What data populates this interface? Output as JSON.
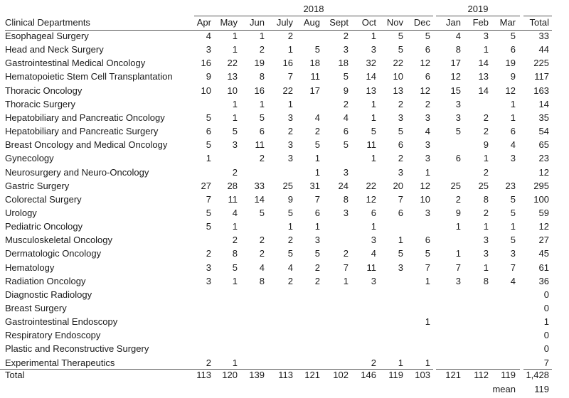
{
  "table": {
    "stub_header": "Clinical Departments",
    "year_groups": [
      {
        "label": "2018",
        "months": [
          "Apr",
          "May",
          "Jun",
          "July",
          "Aug",
          "Sept",
          "Oct",
          "Nov",
          "Dec"
        ]
      },
      {
        "label": "2019",
        "months": [
          "Jan",
          "Feb",
          "Mar"
        ]
      }
    ],
    "columns": [
      "Apr",
      "May",
      "Jun",
      "July",
      "Aug",
      "Sept",
      "Oct",
      "Nov",
      "Dec",
      "Jan",
      "Feb",
      "Mar",
      "Total"
    ],
    "rows": [
      {
        "dept": "Esophageal Surgery",
        "values": [
          "4",
          "1",
          "1",
          "2",
          "",
          "2",
          "1",
          "5",
          "5",
          "4",
          "3",
          "5",
          "33"
        ]
      },
      {
        "dept": "Head and Neck Surgery",
        "values": [
          "3",
          "1",
          "2",
          "1",
          "5",
          "3",
          "3",
          "5",
          "6",
          "8",
          "1",
          "6",
          "44"
        ]
      },
      {
        "dept": "Gastrointestinal Medical Oncology",
        "values": [
          "16",
          "22",
          "19",
          "16",
          "18",
          "18",
          "32",
          "22",
          "12",
          "17",
          "14",
          "19",
          "225"
        ]
      },
      {
        "dept": "Hematopoietic Stem Cell Transplantation",
        "values": [
          "9",
          "13",
          "8",
          "7",
          "11",
          "5",
          "14",
          "10",
          "6",
          "12",
          "13",
          "9",
          "117"
        ]
      },
      {
        "dept": "Thoracic Oncology",
        "values": [
          "10",
          "10",
          "16",
          "22",
          "17",
          "9",
          "13",
          "13",
          "12",
          "15",
          "14",
          "12",
          "163"
        ]
      },
      {
        "dept": "Thoracic Surgery",
        "values": [
          "",
          "1",
          "1",
          "1",
          "",
          "2",
          "1",
          "2",
          "2",
          "3",
          "",
          "1",
          "14"
        ]
      },
      {
        "dept": "Hepatobiliary and Pancreatic Oncology",
        "values": [
          "5",
          "1",
          "5",
          "3",
          "4",
          "4",
          "1",
          "3",
          "3",
          "3",
          "2",
          "1",
          "35"
        ]
      },
      {
        "dept": "Hepatobiliary and Pancreatic Surgery",
        "values": [
          "6",
          "5",
          "6",
          "2",
          "2",
          "6",
          "5",
          "5",
          "4",
          "5",
          "2",
          "6",
          "54"
        ]
      },
      {
        "dept": "Breast Oncology and Medical Oncology",
        "values": [
          "5",
          "3",
          "11",
          "3",
          "5",
          "5",
          "11",
          "6",
          "3",
          "",
          "9",
          "4",
          "65"
        ]
      },
      {
        "dept": "Gynecology",
        "values": [
          "1",
          "",
          "2",
          "3",
          "1",
          "",
          "1",
          "2",
          "3",
          "6",
          "1",
          "3",
          "23"
        ]
      },
      {
        "dept": "Neurosurgery and Neuro-Oncology",
        "values": [
          "",
          "2",
          "",
          "",
          "1",
          "3",
          "",
          "3",
          "1",
          "",
          "2",
          "",
          "12"
        ]
      },
      {
        "dept": "Gastric Surgery",
        "values": [
          "27",
          "28",
          "33",
          "25",
          "31",
          "24",
          "22",
          "20",
          "12",
          "25",
          "25",
          "23",
          "295"
        ]
      },
      {
        "dept": "Colorectal Surgery",
        "values": [
          "7",
          "11",
          "14",
          "9",
          "7",
          "8",
          "12",
          "7",
          "10",
          "2",
          "8",
          "5",
          "100"
        ]
      },
      {
        "dept": "Urology",
        "values": [
          "5",
          "4",
          "5",
          "5",
          "6",
          "3",
          "6",
          "6",
          "3",
          "9",
          "2",
          "5",
          "59"
        ]
      },
      {
        "dept": "Pediatric Oncology",
        "values": [
          "5",
          "1",
          "",
          "1",
          "1",
          "",
          "1",
          "",
          "",
          "1",
          "1",
          "1",
          "12"
        ]
      },
      {
        "dept": "Musculoskeletal Oncology",
        "values": [
          "",
          "2",
          "2",
          "2",
          "3",
          "",
          "3",
          "1",
          "6",
          "",
          "3",
          "5",
          "27"
        ]
      },
      {
        "dept": "Dermatologic Oncology",
        "values": [
          "2",
          "8",
          "2",
          "5",
          "5",
          "2",
          "4",
          "5",
          "5",
          "1",
          "3",
          "3",
          "45"
        ]
      },
      {
        "dept": "Hematology",
        "values": [
          "3",
          "5",
          "4",
          "4",
          "2",
          "7",
          "11",
          "3",
          "7",
          "7",
          "1",
          "7",
          "61"
        ]
      },
      {
        "dept": "Radiation Oncology",
        "values": [
          "3",
          "1",
          "8",
          "2",
          "2",
          "1",
          "3",
          "",
          "1",
          "3",
          "8",
          "4",
          "36"
        ]
      },
      {
        "dept": "Diagnostic Radiology",
        "values": [
          "",
          "",
          "",
          "",
          "",
          "",
          "",
          "",
          "",
          "",
          "",
          "",
          "0"
        ]
      },
      {
        "dept": "Breast Surgery",
        "values": [
          "",
          "",
          "",
          "",
          "",
          "",
          "",
          "",
          "",
          "",
          "",
          "",
          "0"
        ]
      },
      {
        "dept": "Gastrointestinal Endoscopy",
        "values": [
          "",
          "",
          "",
          "",
          "",
          "",
          "",
          "",
          "1",
          "",
          "",
          "",
          "1"
        ]
      },
      {
        "dept": "Respiratory Endoscopy",
        "values": [
          "",
          "",
          "",
          "",
          "",
          "",
          "",
          "",
          "",
          "",
          "",
          "",
          "0"
        ]
      },
      {
        "dept": "Plastic and Reconstructive Surgery",
        "values": [
          "",
          "",
          "",
          "",
          "",
          "",
          "",
          "",
          "",
          "",
          "",
          "",
          "0"
        ]
      },
      {
        "dept": "Experimental Therapeutics",
        "values": [
          "2",
          "1",
          "",
          "",
          "",
          "",
          "2",
          "1",
          "1",
          "",
          "",
          "",
          "7"
        ]
      }
    ],
    "total_row": {
      "label": "Total",
      "values": [
        "113",
        "120",
        "139",
        "113",
        "121",
        "102",
        "146",
        "119",
        "103",
        "121",
        "112",
        "119",
        "1,428"
      ]
    },
    "mean_row": {
      "label": "mean",
      "value": "119"
    }
  }
}
